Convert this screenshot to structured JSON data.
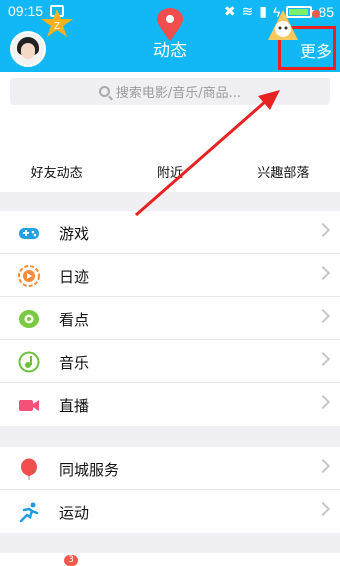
{
  "statusbar": {
    "time": "09:15",
    "battery": "85"
  },
  "header": {
    "title": "动态",
    "more": "更多"
  },
  "search": {
    "placeholder": "搜索电影/音乐/商品..."
  },
  "quick": {
    "friends": "好友动态",
    "nearby": "附近",
    "tribe": "兴趣部落"
  },
  "group1": [
    {
      "label": "游戏"
    },
    {
      "label": "日迹"
    },
    {
      "label": "看点"
    },
    {
      "label": "音乐"
    },
    {
      "label": "直播"
    }
  ],
  "group2": [
    {
      "label": "同城服务"
    },
    {
      "label": "运动"
    }
  ],
  "bottom": {
    "badge": "3"
  },
  "colors": {
    "brand": "#12b7f5",
    "highlight": "#e82222"
  }
}
